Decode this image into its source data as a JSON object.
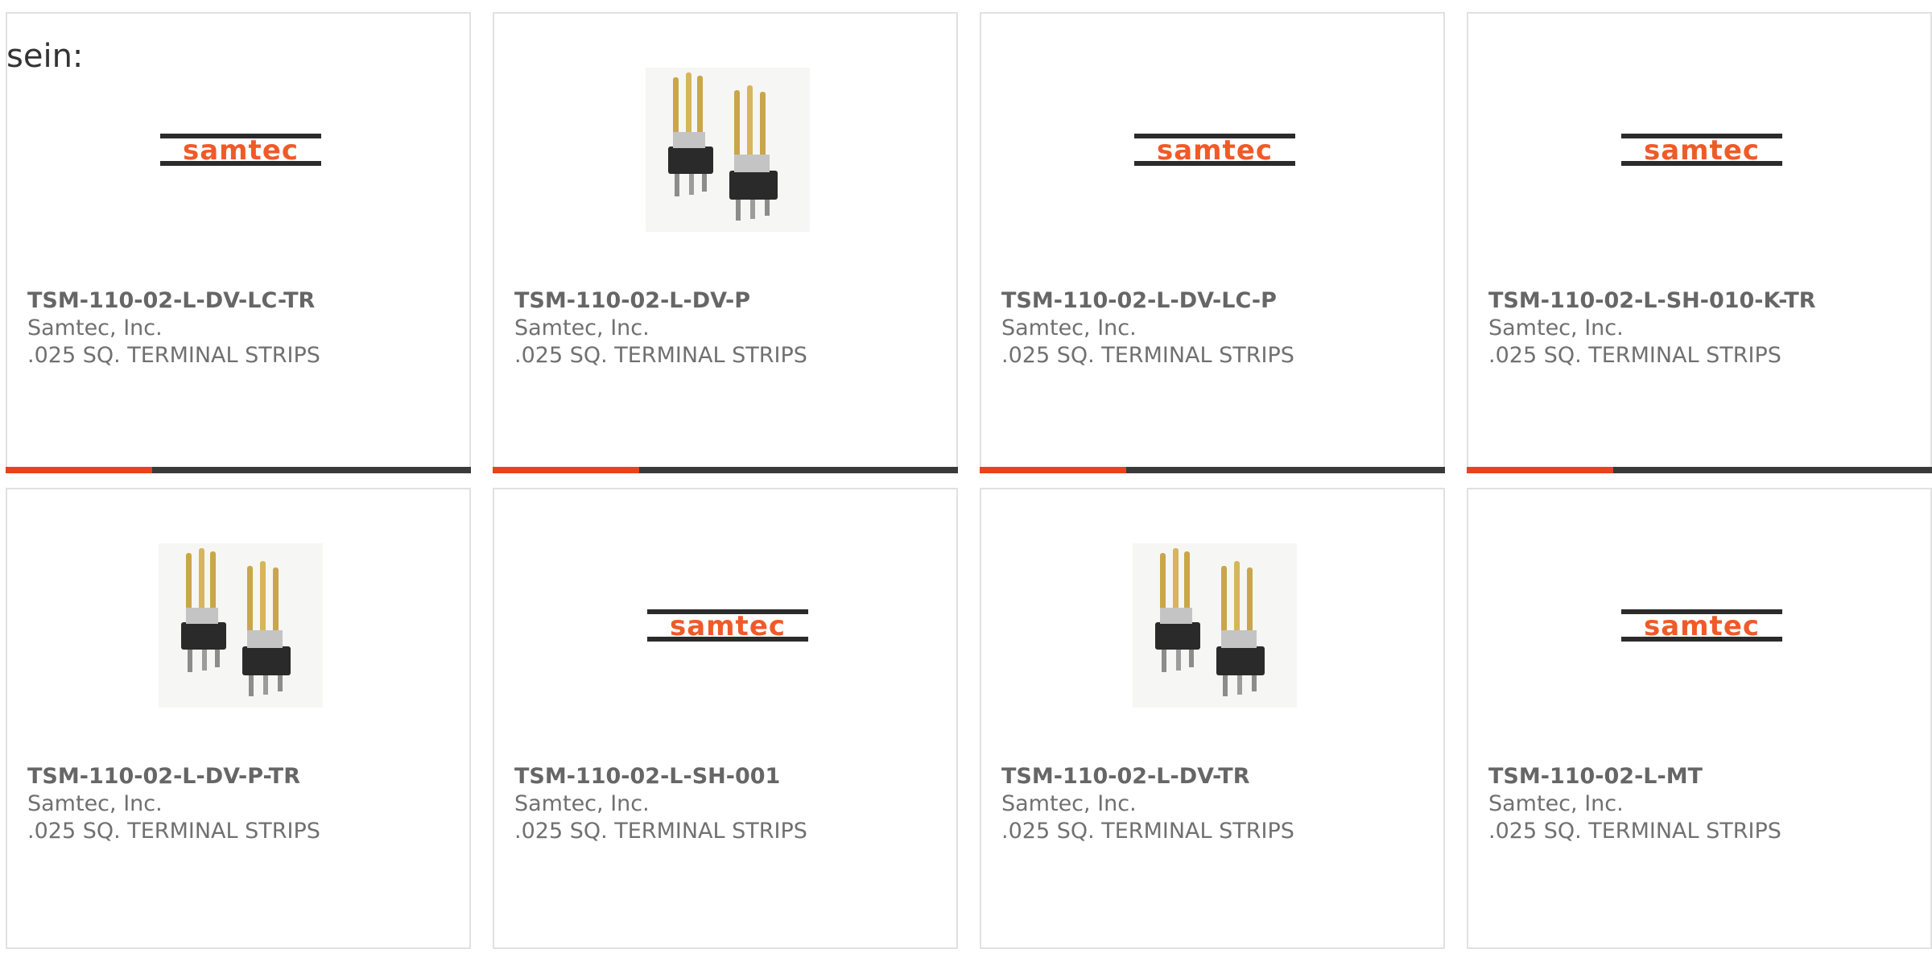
{
  "intro": {
    "text": "sein:"
  },
  "colors": {
    "accent": "#e8431c",
    "bar": "#3a3a3a",
    "logo_orange": "#f05a28",
    "logo_dark": "#2b2b2b"
  },
  "products": [
    {
      "part_number": "TSM-110-02-L-DV-LC-TR",
      "manufacturer": "Samtec, Inc.",
      "description": ".025 SQ. TERMINAL STRIPS",
      "image": "samtec-logo",
      "logo_text": "samtec",
      "accent_bar": true
    },
    {
      "part_number": "TSM-110-02-L-DV-P",
      "manufacturer": "Samtec, Inc.",
      "description": ".025 SQ. TERMINAL STRIPS",
      "image": "header-connector",
      "accent_bar": true
    },
    {
      "part_number": "TSM-110-02-L-DV-LC-P",
      "manufacturer": "Samtec, Inc.",
      "description": ".025 SQ. TERMINAL STRIPS",
      "image": "samtec-logo",
      "logo_text": "samtec",
      "accent_bar": true
    },
    {
      "part_number": "TSM-110-02-L-SH-010-K-TR",
      "manufacturer": "Samtec, Inc.",
      "description": ".025 SQ. TERMINAL STRIPS",
      "image": "samtec-logo",
      "logo_text": "samtec",
      "accent_bar": true
    },
    {
      "part_number": "TSM-110-02-L-DV-P-TR",
      "manufacturer": "Samtec, Inc.",
      "description": ".025 SQ. TERMINAL STRIPS",
      "image": "header-connector",
      "accent_bar": false
    },
    {
      "part_number": "TSM-110-02-L-SH-001",
      "manufacturer": "Samtec, Inc.",
      "description": ".025 SQ. TERMINAL STRIPS",
      "image": "samtec-logo",
      "logo_text": "samtec",
      "accent_bar": false
    },
    {
      "part_number": "TSM-110-02-L-DV-TR",
      "manufacturer": "Samtec, Inc.",
      "description": ".025 SQ. TERMINAL STRIPS",
      "image": "header-connector",
      "accent_bar": false
    },
    {
      "part_number": "TSM-110-02-L-MT",
      "manufacturer": "Samtec, Inc.",
      "description": ".025 SQ. TERMINAL STRIPS",
      "image": "samtec-logo",
      "logo_text": "samtec",
      "accent_bar": false
    }
  ]
}
